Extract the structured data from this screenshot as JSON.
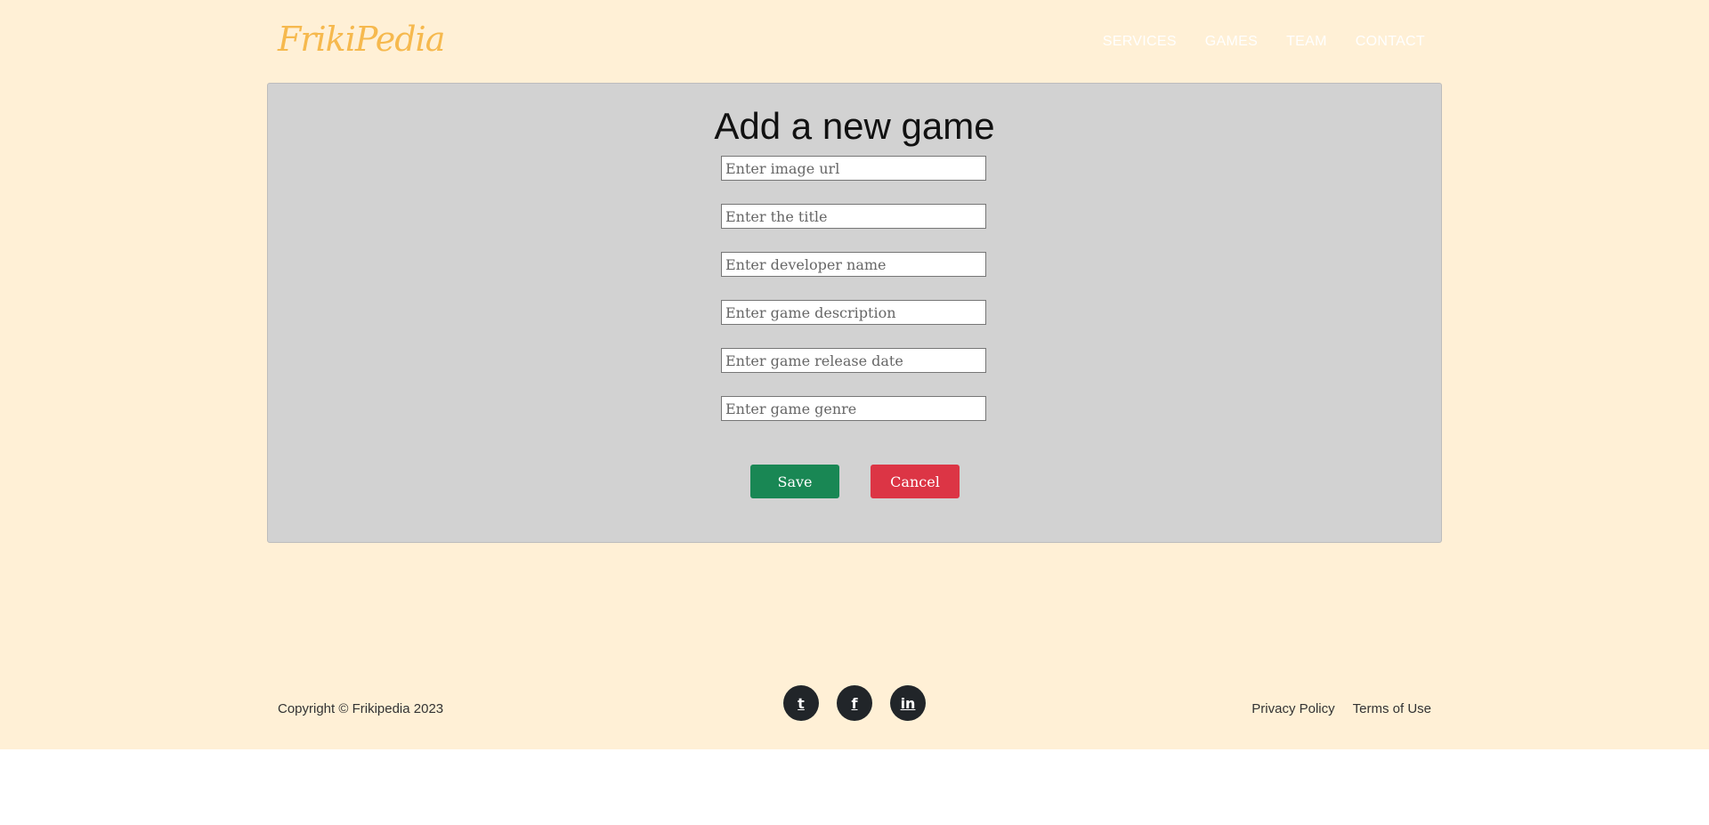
{
  "brand": {
    "logo_text": "FrikiPedia"
  },
  "nav": {
    "items": [
      {
        "label": "SERVICES"
      },
      {
        "label": "GAMES"
      },
      {
        "label": "TEAM"
      },
      {
        "label": "CONTACT"
      }
    ]
  },
  "form": {
    "title": "Add a new game",
    "fields": [
      {
        "placeholder": "Enter image url",
        "value": ""
      },
      {
        "placeholder": "Enter the title",
        "value": ""
      },
      {
        "placeholder": "Enter developer name",
        "value": ""
      },
      {
        "placeholder": "Enter game description",
        "value": ""
      },
      {
        "placeholder": "Enter game release date",
        "value": ""
      },
      {
        "placeholder": "Enter game genre",
        "value": ""
      }
    ],
    "save_label": "Save",
    "cancel_label": "Cancel"
  },
  "footer": {
    "copyright": "Copyright © Frikipedia 2023",
    "social": [
      {
        "icon": "twitter-icon",
        "glyph": "t"
      },
      {
        "icon": "facebook-icon",
        "glyph": "f"
      },
      {
        "icon": "linkedin-icon",
        "glyph": "in"
      }
    ],
    "links": [
      {
        "label": "Privacy Policy"
      },
      {
        "label": "Terms of Use"
      }
    ]
  },
  "colors": {
    "page_bg": "#fff0d6",
    "card_bg": "#d2d2d2",
    "logo": "#f6b94e",
    "save": "#198754",
    "cancel": "#dc3545",
    "social_bg": "#212529"
  }
}
